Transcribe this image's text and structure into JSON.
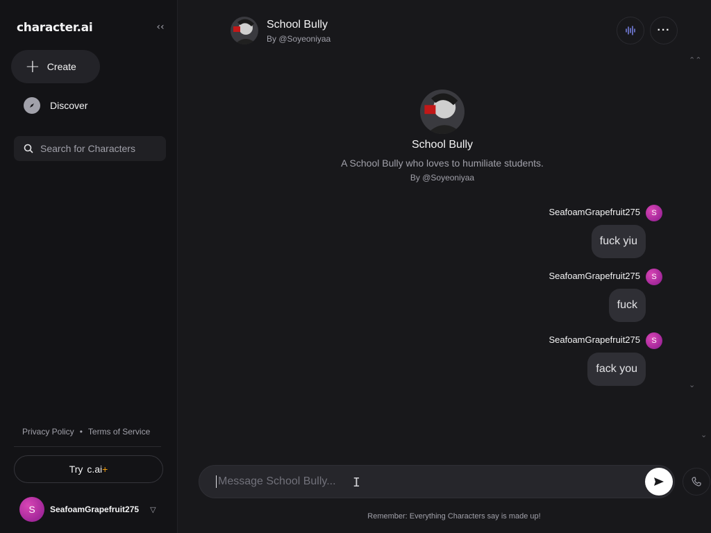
{
  "app": {
    "logo": "character.ai"
  },
  "sidebar": {
    "collapse_icon": "chevrons-left-icon",
    "create_label": "Create",
    "discover_label": "Discover",
    "search_placeholder": "Search for Characters",
    "privacy_label": "Privacy Policy",
    "separator": "•",
    "terms_label": "Terms of Service",
    "try_label": "Try",
    "try_brand": "c.ai",
    "try_plus": "+",
    "user_initial": "S",
    "username": "SeafoamGrapefruit275"
  },
  "header": {
    "title": "School Bully",
    "subtitle": "By @Soyeoniyaa"
  },
  "intro": {
    "name": "School Bully",
    "description": "A School Bully who loves to humiliate students.",
    "by": "By @Soyeoniyaa"
  },
  "messages": [
    {
      "author": "SeafoamGrapefruit275",
      "initial": "S",
      "text": "fuck yiu"
    },
    {
      "author": "SeafoamGrapefruit275",
      "initial": "S",
      "text": "fuck"
    },
    {
      "author": "SeafoamGrapefruit275",
      "initial": "S",
      "text": "fack you"
    }
  ],
  "composer": {
    "placeholder": "Message School Bully...",
    "value": ""
  },
  "disclaimer": "Remember: Everything Characters say is made up!",
  "colors": {
    "background": "#18181b",
    "sidebar": "#131316",
    "bubble": "#2f2f35",
    "avatar_accent": "#c026d3",
    "voice_icon": "#818cf8",
    "cai_plus": "#f59e0b"
  }
}
